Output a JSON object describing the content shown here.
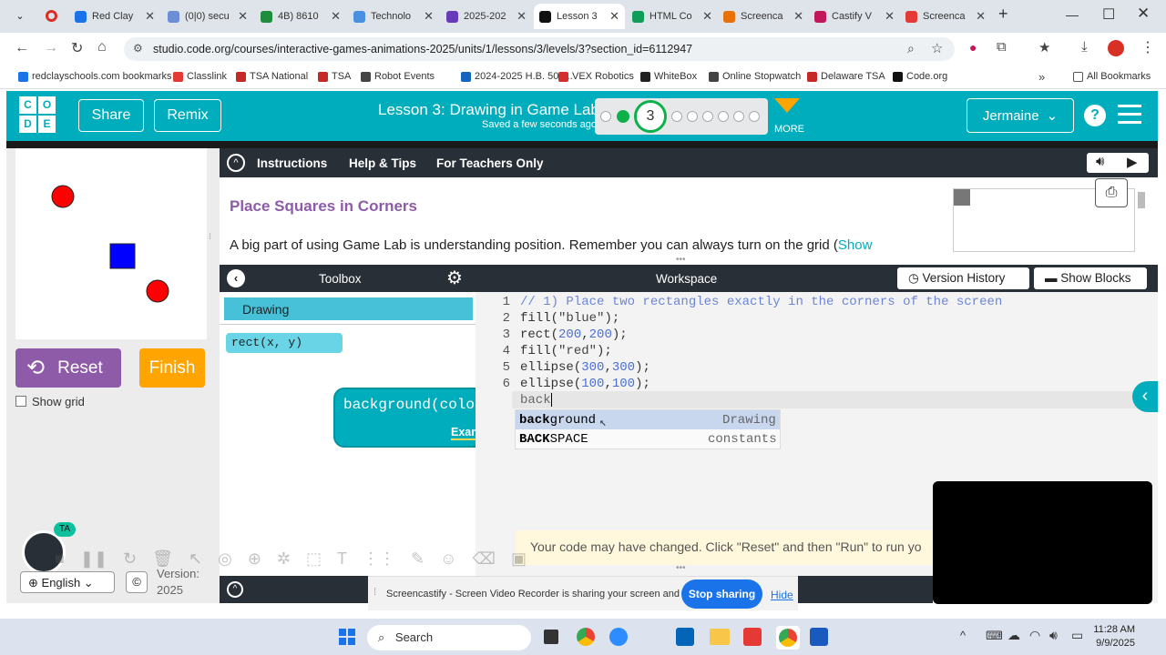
{
  "browser": {
    "tabs": [
      {
        "label": "Red Clay",
        "color": "#1a73e8"
      },
      {
        "label": "(0|0) secu",
        "color": "#6b8ed6"
      },
      {
        "label": "4B) 8610",
        "color": "#1e8e3e"
      },
      {
        "label": "Technolo",
        "color": "#4a90e2"
      },
      {
        "label": "2025-202",
        "color": "#673ab7"
      },
      {
        "label": "Lesson 3",
        "color": "#111111"
      },
      {
        "label": "HTML Co",
        "color": "#0f9d58"
      },
      {
        "label": "Screenca",
        "color": "#e8710a"
      },
      {
        "label": "Castify V",
        "color": "#c2185b"
      },
      {
        "label": "Screenca",
        "color": "#e53935"
      }
    ],
    "url": "studio.code.org/courses/interactive-games-animations-2025/units/1/lessons/3/levels/3?section_id=6112947",
    "bookmarks": [
      "redclayschools.com bookmarks",
      "Classlink",
      "TSA National",
      "TSA",
      "Robot Events",
      "2024-2025 H.B. 509...",
      "VEX Robotics",
      "WhiteBox",
      "Online Stopwatch",
      "Delaware TSA",
      "Code.org"
    ],
    "all_bookmarks": "All Bookmarks"
  },
  "header": {
    "logo_letters": [
      "C",
      "O",
      "D",
      "E"
    ],
    "share": "Share",
    "remix": "Remix",
    "lesson_title": "Lesson 3: Drawing in Game Lab",
    "saved_status": "Saved a few seconds ago",
    "current_level": "3",
    "more": "MORE",
    "user": "Jermaine",
    "help": "?"
  },
  "instructions": {
    "tabs": [
      "Instructions",
      "Help & Tips",
      "For Teachers Only"
    ],
    "heading": "Place Squares in Corners",
    "body": "A big part of using Game Lab is understanding position. Remember you can always turn on the grid (",
    "show_link": "Show"
  },
  "controls": {
    "reset": "Reset",
    "finish": "Finish",
    "show_grid": "Show grid",
    "language": "English",
    "version_label": "Version:",
    "version_value": "2025",
    "avatar_badge": "TA"
  },
  "toolbox": {
    "title": "Toolbox",
    "category": "Drawing",
    "block": "rect(x, y)",
    "tooltip_signature": "background(color)",
    "tooltip_examples": "Examples"
  },
  "workspace": {
    "title": "Workspace",
    "version_history": "Version History",
    "show_blocks": "Show Blocks",
    "line_numbers": [
      "1",
      "2",
      "3",
      "4",
      "5",
      "6",
      "7"
    ],
    "code": {
      "l1": "// 1) Place two rectangles exactly in the corners of the screen",
      "l2a": "fill(",
      "l2b": "\"blue\"",
      "l2c": ");",
      "l3a": "rect(",
      "l3b": "200",
      "l3c": ",",
      "l3d": "200",
      "l3e": ");",
      "l4a": "fill(",
      "l4b": "\"red\"",
      "l4c": ");",
      "l5a": "ellipse(",
      "l5b": "300",
      "l5c": ",",
      "l5d": "300",
      "l5e": ");",
      "l6a": "ellipse(",
      "l6b": "100",
      "l6c": ",",
      "l6d": "100",
      "l6e": ");",
      "l7": "back"
    },
    "autocomplete": [
      {
        "match": "back",
        "rest": "ground",
        "category": "Drawing"
      },
      {
        "match": "BACK",
        "rest": "SPACE",
        "category": "constants"
      }
    ],
    "changed_notice": "Your code may have changed. Click \"Reset\" and then \"Run\" to run yo"
  },
  "screencastify": {
    "message": "Screencastify - Screen Video Recorder is sharing your screen and audio.",
    "stop": "Stop sharing",
    "hide": "Hide"
  },
  "taskbar": {
    "search": "Search",
    "time": "11:28 AM",
    "date": "9/9/2025"
  },
  "colors": {
    "codeorg_teal": "#00adbc",
    "reset_purple": "#8e5ba8",
    "finish_orange": "#ffa400",
    "heading_purple": "#8e5ba8",
    "stop_blue": "#1a73e8"
  }
}
